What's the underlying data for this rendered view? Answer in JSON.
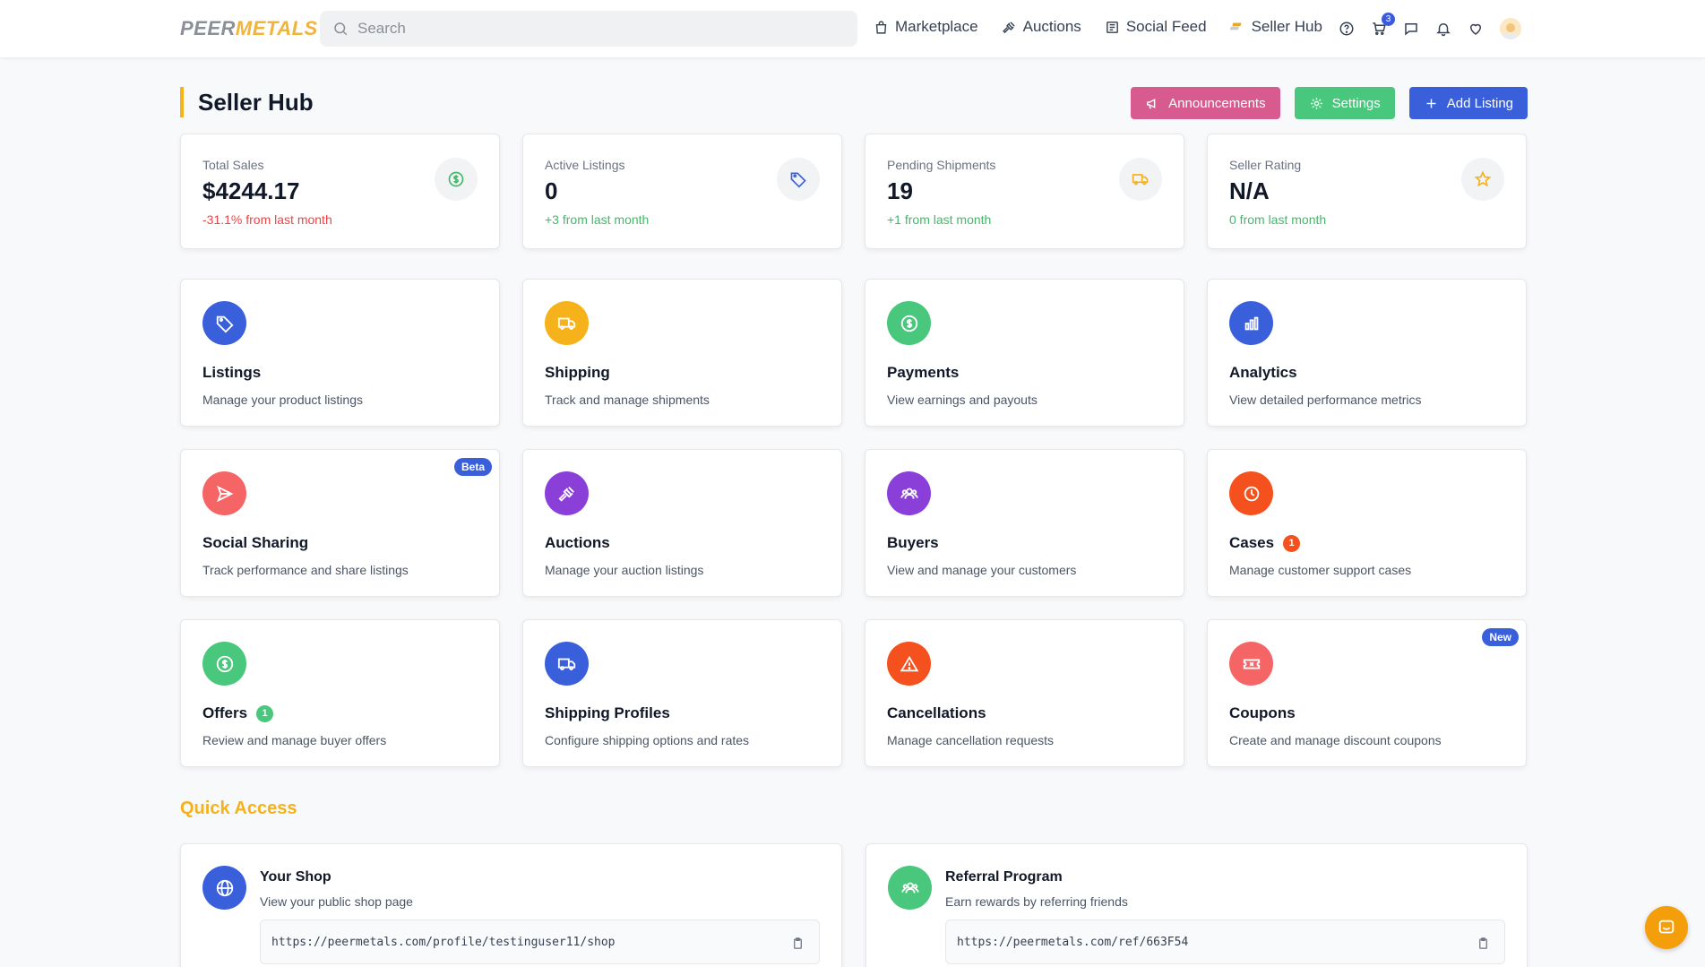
{
  "nav": {
    "logo_part1": "PEER",
    "logo_part2": "METALS",
    "search_placeholder": "Search",
    "links": [
      {
        "label": "Marketplace",
        "icon": "bag-icon"
      },
      {
        "label": "Auctions",
        "icon": "gavel-icon"
      },
      {
        "label": "Social Feed",
        "icon": "newspaper-icon"
      },
      {
        "label": "Seller Hub",
        "icon": "gold-bars-icon"
      }
    ],
    "cart_count": "3"
  },
  "header": {
    "title": "Seller Hub",
    "buttons": {
      "announcements": "Announcements",
      "settings": "Settings",
      "add_listing": "Add Listing"
    }
  },
  "stats": [
    {
      "label": "Total Sales",
      "value": "$4244.17",
      "change": "-31.1% from last month",
      "trend": "negative",
      "icon": "dollar-icon",
      "color": "#43b86b"
    },
    {
      "label": "Active Listings",
      "value": "0",
      "change": "+3 from last month",
      "trend": "positive",
      "icon": "tag-icon",
      "color": "#3a5fdb"
    },
    {
      "label": "Pending Shipments",
      "value": "19",
      "change": "+1 from last month",
      "trend": "positive",
      "icon": "truck-icon",
      "color": "#f5b21a"
    },
    {
      "label": "Seller Rating",
      "value": "N/A",
      "change": "0 from last month",
      "trend": "positive",
      "icon": "star-icon",
      "color": "#f5b21a"
    }
  ],
  "features": [
    {
      "title": "Listings",
      "desc": "Manage your product listings",
      "icon": "tag-icon",
      "color": "#3a5fdb"
    },
    {
      "title": "Shipping",
      "desc": "Track and manage shipments",
      "icon": "truck-icon",
      "color": "#f5b21a"
    },
    {
      "title": "Payments",
      "desc": "View earnings and payouts",
      "icon": "dollar-icon",
      "color": "#49c77c"
    },
    {
      "title": "Analytics",
      "desc": "View detailed performance metrics",
      "icon": "bar-chart-icon",
      "color": "#3a5fdb"
    },
    {
      "title": "Social Sharing",
      "desc": "Track performance and share listings",
      "icon": "send-icon",
      "color": "#f56565",
      "badge": "Beta"
    },
    {
      "title": "Auctions",
      "desc": "Manage your auction listings",
      "icon": "gavel-icon",
      "color": "#8b3fd9"
    },
    {
      "title": "Buyers",
      "desc": "View and manage your customers",
      "icon": "users-icon",
      "color": "#8b3fd9"
    },
    {
      "title": "Cases",
      "desc": "Manage customer support cases",
      "icon": "clock-icon",
      "color": "#f4511e",
      "count": "1",
      "count_color": "#f4511e"
    },
    {
      "title": "Offers",
      "desc": "Review and manage buyer offers",
      "icon": "dollar-icon",
      "color": "#49c77c",
      "count": "1",
      "count_color": "#49c77c"
    },
    {
      "title": "Shipping Profiles",
      "desc": "Configure shipping options and rates",
      "icon": "truck-icon",
      "color": "#3a5fdb"
    },
    {
      "title": "Cancellations",
      "desc": "Manage cancellation requests",
      "icon": "warning-icon",
      "color": "#f4511e"
    },
    {
      "title": "Coupons",
      "desc": "Create and manage discount coupons",
      "icon": "ticket-icon",
      "color": "#f56565",
      "badge": "New"
    }
  ],
  "quick_access": {
    "title": "Quick Access",
    "cards": [
      {
        "name": "Your Shop",
        "desc": "View your public shop page",
        "url": "https://peermetals.com/profile/testinguser11/shop",
        "icon": "globe-icon",
        "color": "#3a5fdb"
      },
      {
        "name": "Referral Program",
        "desc": "Earn rewards by referring friends",
        "url": "https://peermetals.com/ref/663F54",
        "icon": "users-icon",
        "color": "#49c77c"
      }
    ]
  },
  "colors": {
    "accent_yellow": "#f5b21a",
    "primary_blue": "#3a5fdb",
    "green": "#49c77c",
    "pink": "#d75b8f"
  }
}
